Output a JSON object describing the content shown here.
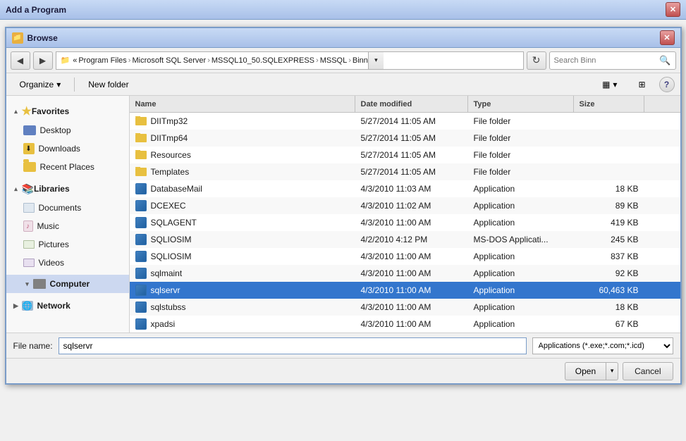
{
  "outer": {
    "title": "Add a Program",
    "close_label": "✕"
  },
  "browse": {
    "title": "Browse",
    "title_icon": "📁",
    "close_label": "✕"
  },
  "address": {
    "back_label": "◀",
    "forward_label": "▶",
    "up_label": "↑",
    "path_icon": "📁",
    "path_parts": [
      "Program Files",
      "Microsoft SQL Server",
      "MSSQL10_50.SQLEXPRESS",
      "MSSQL",
      "Binn"
    ],
    "refresh_label": "↻",
    "search_placeholder": "Search Binn"
  },
  "toolbar": {
    "organize_label": "Organize",
    "organize_arrow": "▾",
    "new_folder_label": "New folder",
    "help_label": "?"
  },
  "columns": {
    "name": "Name",
    "date_modified": "Date modified",
    "type": "Type",
    "size": "Size"
  },
  "files": [
    {
      "name": "DIITmp32",
      "date": "5/27/2014 11:05 AM",
      "type": "File folder",
      "size": "",
      "icon": "folder"
    },
    {
      "name": "DIITmp64",
      "date": "5/27/2014 11:05 AM",
      "type": "File folder",
      "size": "",
      "icon": "folder"
    },
    {
      "name": "Resources",
      "date": "5/27/2014 11:05 AM",
      "type": "File folder",
      "size": "",
      "icon": "folder"
    },
    {
      "name": "Templates",
      "date": "5/27/2014 11:05 AM",
      "type": "File folder",
      "size": "",
      "icon": "folder"
    },
    {
      "name": "DatabaseMail",
      "date": "4/3/2010 11:03 AM",
      "type": "Application",
      "size": "18 KB",
      "icon": "exe"
    },
    {
      "name": "DCEXEC",
      "date": "4/3/2010 11:02 AM",
      "type": "Application",
      "size": "89 KB",
      "icon": "exe"
    },
    {
      "name": "SQLAGENT",
      "date": "4/3/2010 11:00 AM",
      "type": "Application",
      "size": "419 KB",
      "icon": "exe"
    },
    {
      "name": "SQLIOSIM",
      "date": "4/2/2010 4:12 PM",
      "type": "MS-DOS Applicati...",
      "size": "245 KB",
      "icon": "exe"
    },
    {
      "name": "SQLIOSIM",
      "date": "4/3/2010 11:00 AM",
      "type": "Application",
      "size": "837 KB",
      "icon": "exe"
    },
    {
      "name": "sqlmaint",
      "date": "4/3/2010 11:00 AM",
      "type": "Application",
      "size": "92 KB",
      "icon": "exe"
    },
    {
      "name": "sqlservr",
      "date": "4/3/2010 11:00 AM",
      "type": "Application",
      "size": "60,463 KB",
      "icon": "exe",
      "selected": true
    },
    {
      "name": "sqlstubss",
      "date": "4/3/2010 11:00 AM",
      "type": "Application",
      "size": "18 KB",
      "icon": "exe"
    },
    {
      "name": "xpadsi",
      "date": "4/3/2010 11:00 AM",
      "type": "Application",
      "size": "67 KB",
      "icon": "exe"
    }
  ],
  "nav": {
    "favorites_label": "Favorites",
    "desktop_label": "Desktop",
    "downloads_label": "Downloads",
    "recent_label": "Recent Places",
    "libraries_label": "Libraries",
    "documents_label": "Documents",
    "music_label": "Music",
    "pictures_label": "Pictures",
    "videos_label": "Videos",
    "computer_label": "Computer",
    "network_label": "Network"
  },
  "bottom": {
    "filename_label": "File name:",
    "filename_value": "sqlservr",
    "filetype_label": "Applications (*.exe;*.com;*.icd)",
    "open_label": "Open",
    "cancel_label": "Cancel"
  }
}
